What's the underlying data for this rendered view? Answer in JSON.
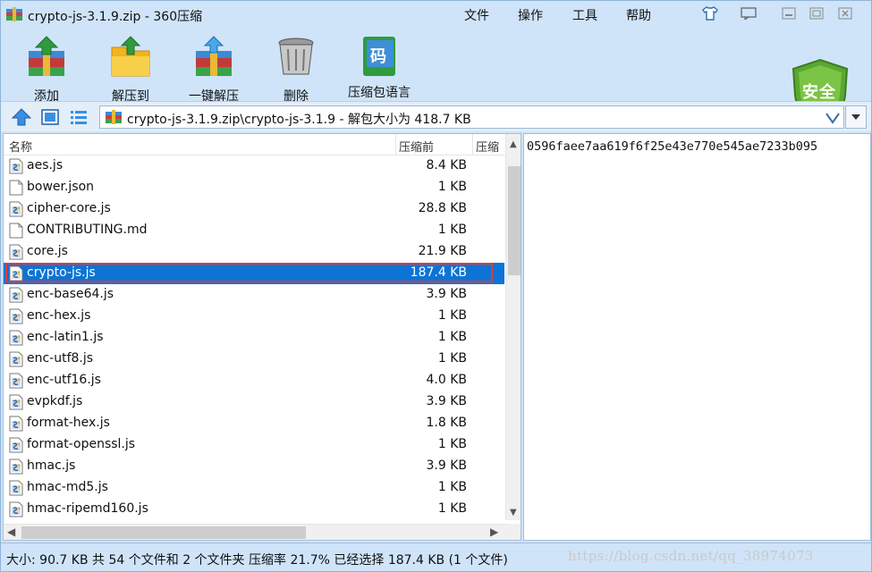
{
  "window": {
    "title": "crypto-js-3.1.9.zip - 360压缩"
  },
  "menu": {
    "items": [
      "文件",
      "操作",
      "工具",
      "帮助"
    ]
  },
  "toolbar": {
    "add": "添加",
    "extract_to": "解压到",
    "one_click_extract": "一键解压",
    "delete": "删除",
    "language": "压缩包语言",
    "language_icon_glyph": "码",
    "security": "安全"
  },
  "address": {
    "path": "crypto-js-3.1.9.zip\\crypto-js-3.1.9 - 解包大小为 418.7 KB"
  },
  "list": {
    "columns": {
      "name": "名称",
      "before": "压缩前",
      "after": "压缩"
    },
    "files": [
      {
        "name": "aes.js",
        "size": "8.4 KB",
        "type": "script"
      },
      {
        "name": "bower.json",
        "size": "1 KB",
        "type": "blank"
      },
      {
        "name": "cipher-core.js",
        "size": "28.8 KB",
        "type": "script"
      },
      {
        "name": "CONTRIBUTING.md",
        "size": "1 KB",
        "type": "blank"
      },
      {
        "name": "core.js",
        "size": "21.9 KB",
        "type": "script"
      },
      {
        "name": "crypto-js.js",
        "size": "187.4 KB",
        "type": "script",
        "selected": true
      },
      {
        "name": "enc-base64.js",
        "size": "3.9 KB",
        "type": "script"
      },
      {
        "name": "enc-hex.js",
        "size": "1 KB",
        "type": "script"
      },
      {
        "name": "enc-latin1.js",
        "size": "1 KB",
        "type": "script"
      },
      {
        "name": "enc-utf8.js",
        "size": "1 KB",
        "type": "script"
      },
      {
        "name": "enc-utf16.js",
        "size": "4.0 KB",
        "type": "script"
      },
      {
        "name": "evpkdf.js",
        "size": "3.9 KB",
        "type": "script"
      },
      {
        "name": "format-hex.js",
        "size": "1.8 KB",
        "type": "script"
      },
      {
        "name": "format-openssl.js",
        "size": "1 KB",
        "type": "script"
      },
      {
        "name": "hmac.js",
        "size": "3.9 KB",
        "type": "script"
      },
      {
        "name": "hmac-md5.js",
        "size": "1 KB",
        "type": "script"
      },
      {
        "name": "hmac-ripemd160.js",
        "size": "1 KB",
        "type": "script"
      }
    ]
  },
  "comment": {
    "text": "0596faee7aa619f6f25e43e770e545ae7233b095"
  },
  "status": {
    "text": "大小: 90.7 KB 共 54 个文件和 2 个文件夹 压缩率 21.7% 已经选择 187.4 KB (1 个文件)",
    "watermark": "https://blog.csdn.net/qq_38974073"
  },
  "colors": {
    "selection": "#0b74d6",
    "highlight_border": "#e23a3a",
    "chrome": "#cfe4f8"
  }
}
